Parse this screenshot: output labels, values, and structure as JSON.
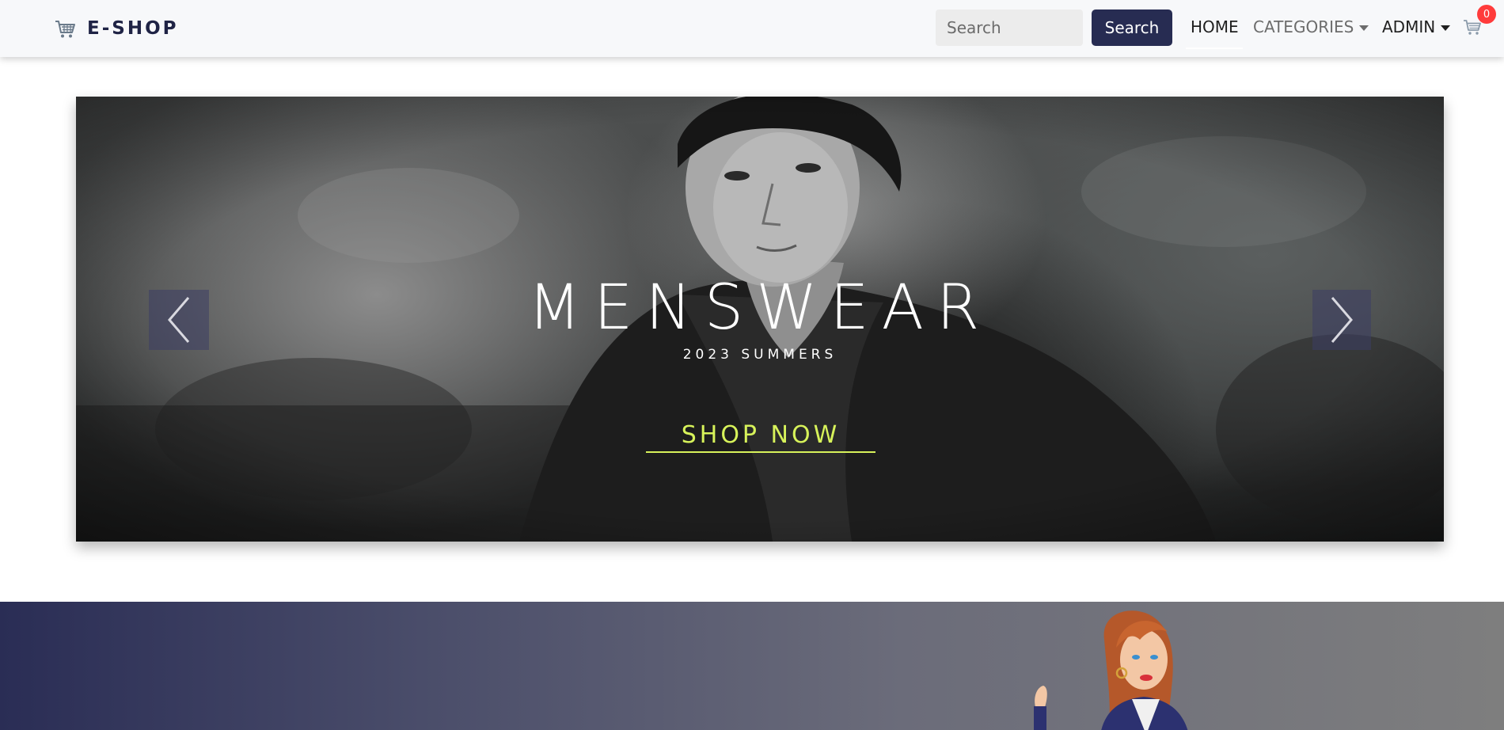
{
  "header": {
    "brand": {
      "text": "E-SHOP",
      "icon": "cart-icon"
    },
    "search": {
      "placeholder": "Search",
      "value": "",
      "button_label": "Search"
    },
    "nav": {
      "home": "HOME",
      "categories": "CATEGORIES",
      "admin": "ADMIN"
    },
    "cart": {
      "icon": "cart-icon",
      "count": "0"
    }
  },
  "hero": {
    "title": "MENSWEAR",
    "subtitle": "2023 SUMMERS",
    "cta": "SHOP NOW",
    "prev_icon": "chevron-left-icon",
    "next_icon": "chevron-right-icon"
  },
  "colors": {
    "brand_dark": "#272c52",
    "nav_bg": "#f7f8fa",
    "badge_red": "#ff3b3b",
    "cta_yellow": "#d7f25a",
    "promo_gradient_start": "#2a2d55",
    "promo_gradient_end": "#7e7e7e"
  }
}
